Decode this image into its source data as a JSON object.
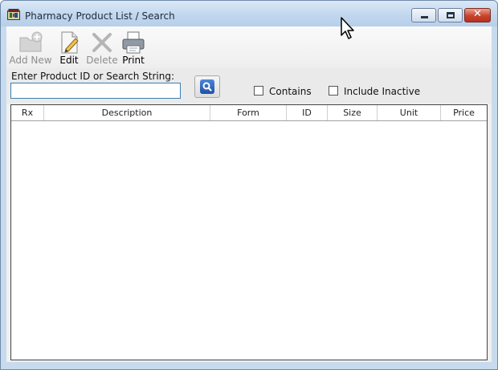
{
  "window": {
    "title": "Pharmacy Product List / Search",
    "controls": {
      "minimize": "minimize",
      "maximize": "maximize",
      "close": "✕"
    }
  },
  "toolbar": {
    "add_new": {
      "label": "Add New",
      "icon": "add-folder-icon",
      "enabled": false
    },
    "edit": {
      "label": "Edit",
      "icon": "edit-document-icon",
      "enabled": true
    },
    "delete": {
      "label": "Delete",
      "icon": "delete-x-icon",
      "enabled": false
    },
    "print": {
      "label": "Print",
      "icon": "printer-icon",
      "enabled": true
    }
  },
  "search": {
    "label": "Enter Product ID or Search String:",
    "value": "",
    "placeholder": "",
    "button_icon": "search-icon"
  },
  "options": {
    "contains": {
      "label": "Contains",
      "checked": false
    },
    "include_inactive": {
      "label": "Include Inactive",
      "checked": false
    }
  },
  "grid": {
    "columns": [
      "Rx",
      "Description",
      "Form",
      "ID",
      "Size",
      "Unit",
      "Price"
    ],
    "rows": []
  },
  "colors": {
    "title_bar": "#c2d7ee",
    "client_bg": "#f0f0f0",
    "close_button": "#c7432d",
    "accent_blue": "#3c7fb1"
  }
}
